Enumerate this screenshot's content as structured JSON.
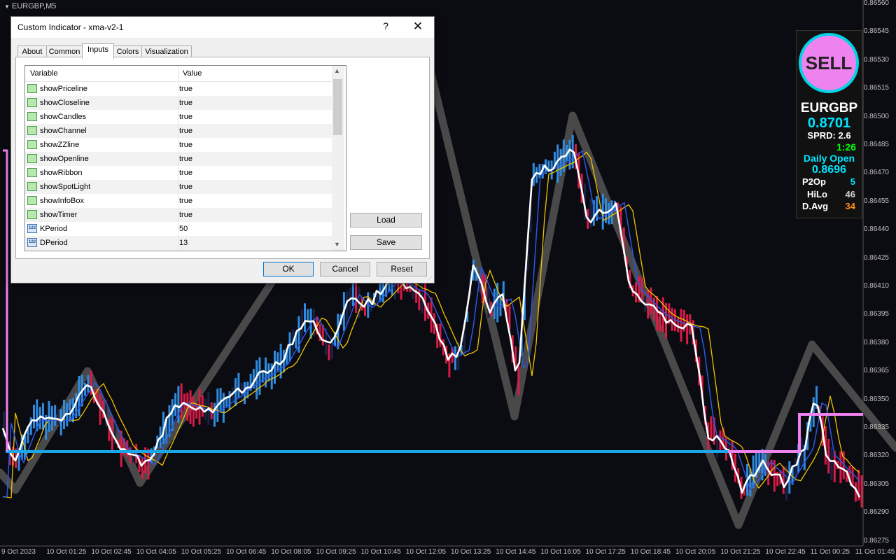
{
  "chart": {
    "symbol_title": "EURGBP,M5",
    "price_axis": [
      "0.86560",
      "0.86545",
      "0.86530",
      "0.86515",
      "0.86500",
      "0.86485",
      "0.86470",
      "0.86455",
      "0.86440",
      "0.86425",
      "0.86410",
      "0.86395",
      "0.86380",
      "0.86365",
      "0.86350",
      "0.86335",
      "0.86320",
      "0.86305",
      "0.86290",
      "0.86275"
    ],
    "time_axis": [
      "9 Oct 2023",
      "10 Oct 01:25",
      "10 Oct 02:45",
      "10 Oct 04:05",
      "10 Oct 05:25",
      "10 Oct 06:45",
      "10 Oct 08:05",
      "10 Oct 09:25",
      "10 Oct 10:45",
      "10 Oct 12:05",
      "10 Oct 13:25",
      "10 Oct 14:45",
      "10 Oct 16:05",
      "10 Oct 17:25",
      "10 Oct 18:45",
      "10 Oct 20:05",
      "10 Oct 21:25",
      "10 Oct 22:45",
      "11 Oct 00:25",
      "11 Oct 01:45"
    ],
    "colors": {
      "background": "#0b0b12",
      "bull": "#2f8be0",
      "bear": "#d81b45",
      "fast_ma": "#ffffff",
      "slow_ma": "#f0c400",
      "signal_ma": "#2b57e6",
      "zigzag": "#505050",
      "openline": "#1aa7e8",
      "pivot": "#ee82ee"
    }
  },
  "infobox": {
    "signal": "SELL",
    "symbol": "EURGBP",
    "price": "0.8701",
    "spread": "SPRD: 2.6",
    "timer": "1:26",
    "daily_open_label": "Daily Open",
    "daily_open_value": "0.8696",
    "rows": [
      {
        "key": "P2Op",
        "value": "5",
        "color": "#00e5ff"
      },
      {
        "key": "HiLo",
        "value": "46",
        "color": "#d0d0d0"
      },
      {
        "key": "D.Avg",
        "value": "34",
        "color": "#ff8c1a"
      }
    ]
  },
  "dialog": {
    "title": "Custom Indicator - xma-v2-1",
    "help": "?",
    "close": "✕",
    "tabs": [
      "About",
      "Common",
      "Inputs",
      "Colors",
      "Visualization"
    ],
    "active_tab": "Inputs",
    "columns": [
      "Variable",
      "Value"
    ],
    "rows": [
      {
        "name": "showPriceline",
        "value": "true",
        "type": "bool"
      },
      {
        "name": "showCloseline",
        "value": "true",
        "type": "bool"
      },
      {
        "name": "showCandles",
        "value": "true",
        "type": "bool"
      },
      {
        "name": "showChannel",
        "value": "true",
        "type": "bool"
      },
      {
        "name": "showZZline",
        "value": "true",
        "type": "bool"
      },
      {
        "name": "showOpenline",
        "value": "true",
        "type": "bool"
      },
      {
        "name": "showRibbon",
        "value": "true",
        "type": "bool"
      },
      {
        "name": "showSpotLight",
        "value": "true",
        "type": "bool"
      },
      {
        "name": "showInfoBox",
        "value": "true",
        "type": "bool"
      },
      {
        "name": "showTimer",
        "value": "true",
        "type": "bool"
      },
      {
        "name": "KPeriod",
        "value": "50",
        "type": "int"
      },
      {
        "name": "DPeriod",
        "value": "13",
        "type": "int"
      }
    ],
    "num_icon_text": "123",
    "buttons": {
      "load": "Load",
      "save": "Save",
      "ok": "OK",
      "cancel": "Cancel",
      "reset": "Reset"
    }
  }
}
